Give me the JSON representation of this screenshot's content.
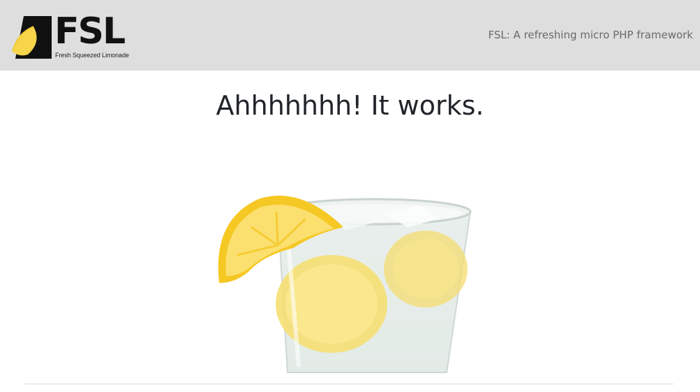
{
  "header": {
    "logo": {
      "wordmark": "FSL",
      "tagline": "Fresh Squeezed Limonade"
    },
    "site_tagline": "FSL: A refreshing micro PHP framework"
  },
  "main": {
    "heading": "Ahhhhhhh! It works.",
    "hero_image": "lemonade-glass-with-lemon-slices"
  },
  "colors": {
    "header_bg": "#dedede",
    "lemon": "#f7d54a",
    "logo_black": "#111111"
  }
}
